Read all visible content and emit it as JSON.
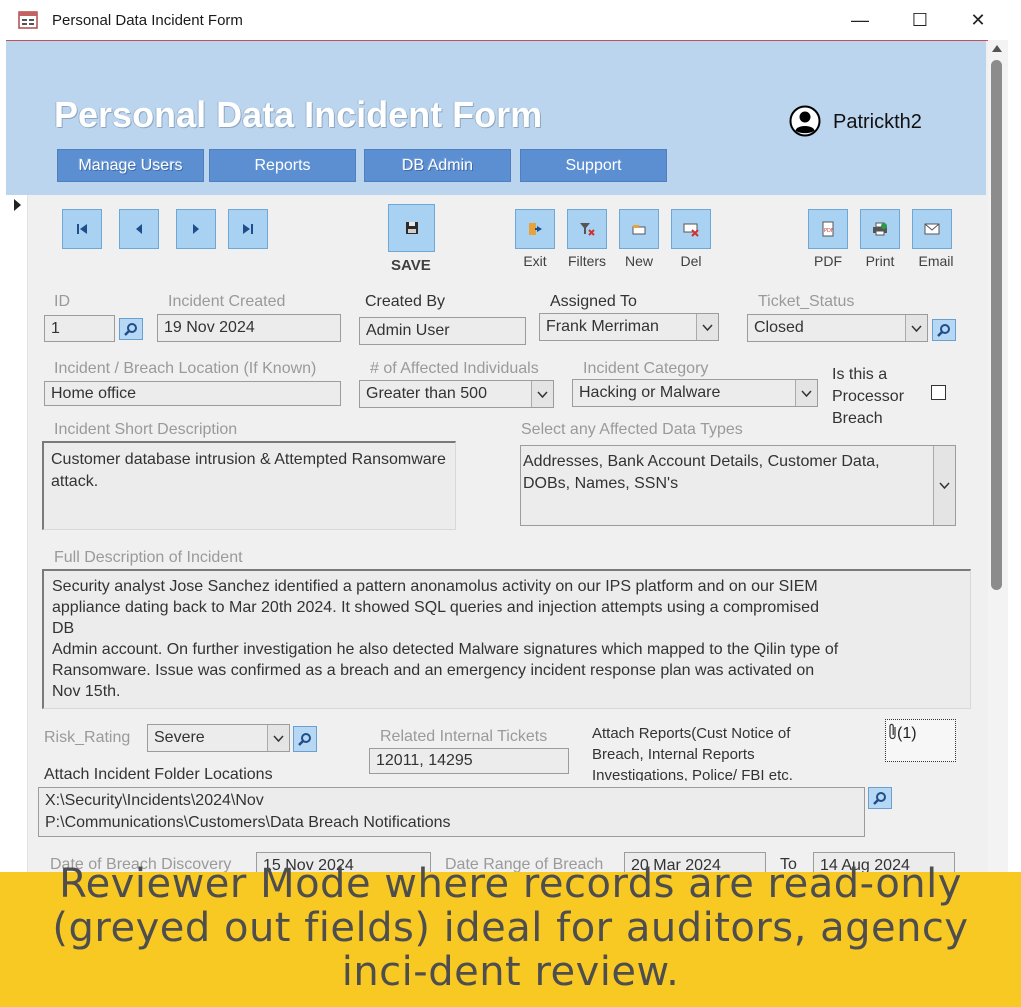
{
  "window": {
    "title": "Personal Data Incident Form",
    "minimize": "—",
    "maximize": "☐",
    "close": "✕"
  },
  "header": {
    "title": "Personal Data Incident Form",
    "user": "Patrickth2",
    "nav": [
      "Manage Users",
      "Reports",
      "DB Admin",
      "Support"
    ]
  },
  "toolbar": {
    "save": "SAVE",
    "exit": "Exit",
    "filters": "Filters",
    "new": "New",
    "del": "Del",
    "pdf": "PDF",
    "print": "Print",
    "email": "Email"
  },
  "form": {
    "id": {
      "label": "ID",
      "value": "1"
    },
    "incident_created": {
      "label": "Incident Created",
      "value": "19 Nov 2024"
    },
    "created_by": {
      "label": "Created By",
      "value": "Admin User"
    },
    "assigned_to": {
      "label": "Assigned To",
      "value": "Frank Merriman"
    },
    "ticket_status": {
      "label": "Ticket_Status",
      "value": "Closed"
    },
    "location": {
      "label": "Incident / Breach Location (If Known)",
      "value": "Home office"
    },
    "affected": {
      "label": "# of Affected Individuals",
      "value": "Greater than 500"
    },
    "category": {
      "label": "Incident Category",
      "value": "Hacking or Malware"
    },
    "processor": {
      "label_1": "Is this a",
      "label_2": "Processor",
      "label_3": "Breach",
      "checked": false
    },
    "short_desc": {
      "label": "Incident Short Description",
      "value": "Customer database intrusion & Attempted Ransomware attack."
    },
    "data_types": {
      "label": "Select any Affected Data Types",
      "value": "Addresses, Bank Account Details, Customer Data, DOBs, Names, SSN's"
    },
    "full_desc": {
      "label": "Full Description of Incident",
      "line_1": "Security analyst Jose Sanchez identified a pattern anonamolus activity on our IPS platform and on our SIEM",
      "line_2": "appliance dating back to Mar 20th 2024. It showed SQL queries and injection attempts using a compromised",
      "line_3": "DB",
      "line_4": "Admin account. On further investigation he also detected Malware signatures which mapped to the Qilin type of",
      "line_5": "Ransomware. Issue was confirmed as a breach and an emergency incident response plan was activated on",
      "line_6": "Nov 15th."
    },
    "risk_rating": {
      "label": "Risk_Rating",
      "value": "Severe"
    },
    "related_tickets": {
      "label": "Related Internal Tickets",
      "value": "12011, 14295"
    },
    "attach_reports": {
      "label_1": "Attach Reports(Cust Notice of",
      "label_2": "Breach, Internal Reports",
      "label_3": "Investigations, Police/ FBI etc.",
      "count": "(1)"
    },
    "folder_locations": {
      "label": "Attach Incident Folder Locations",
      "line_1": "X:\\Security\\Incidents\\2024\\Nov",
      "line_2": "P:\\Communications\\Customers\\Data Breach Notifications"
    },
    "discovery": {
      "label": "Date of Breach Discovery",
      "value": "15 Nov 2024"
    },
    "range": {
      "label": "Date Range of Breach",
      "from": "20 Mar 2024",
      "to_label": "To",
      "to": "14 Aug 2024"
    }
  },
  "banner": {
    "text": "Reviewer Mode where records are read-only (greyed out fields) ideal for auditors, agency inci-dent review."
  },
  "colors": {
    "header_bg": "#bcd5ee",
    "nav_button": "#5b8fd2",
    "toolbar_button": "#a9d1f2",
    "banner": "#f9c923"
  }
}
